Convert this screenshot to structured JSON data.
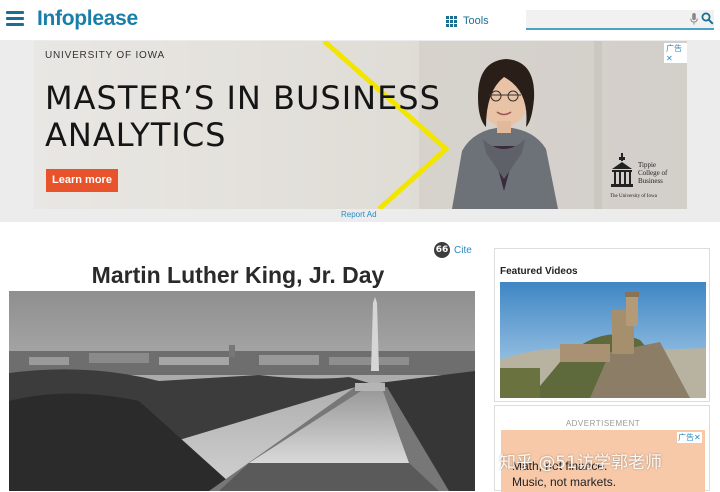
{
  "header": {
    "logo": "Infoplease",
    "tools_label": "Tools",
    "search_placeholder": ""
  },
  "top_ad": {
    "university": "UNIVERSITY OF IOWA",
    "headline_line1": "MASTER’S IN BUSINESS",
    "headline_line2": "ANALYTICS",
    "cta": "Learn more",
    "adchoices": "广告✕",
    "brand_line1": "Tippie",
    "brand_line2": "College of",
    "brand_line3": "Business",
    "brand_sub": "The University of Iowa",
    "report_ad": "Report Ad"
  },
  "article": {
    "cite_label": "Cite",
    "cite_icon_glyph": "66",
    "title": "Martin Luther King, Jr. Day"
  },
  "sidebar": {
    "featured_videos_title": "Featured Videos",
    "ad_label": "ADVERTISEMENT",
    "ad_text_line1": "Math, not finance.",
    "ad_text_line2": "Music, not markets.",
    "ad_choices": "广告✕"
  },
  "watermark": "知乎 @51访学郭老师",
  "colors": {
    "brand": "#1a7fa8",
    "cta": "#e8532b",
    "link": "#2a8ac2"
  }
}
